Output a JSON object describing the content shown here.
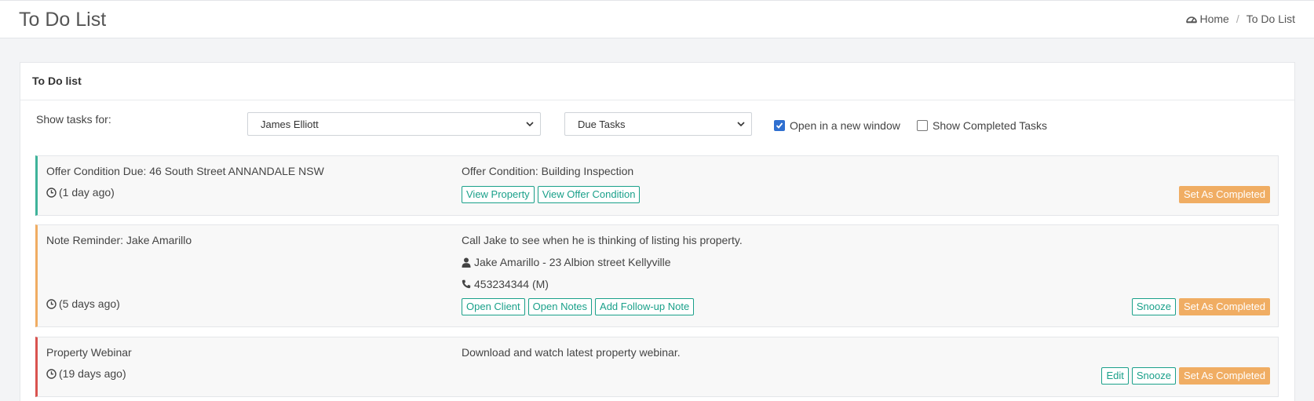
{
  "header": {
    "title": "To Do List",
    "breadcrumb": {
      "home": "Home",
      "current": "To Do List",
      "separator": "/"
    }
  },
  "panel": {
    "title": "To Do list",
    "filters": {
      "label": "Show tasks for:",
      "user_select": "James Elliott",
      "type_select": "Due Tasks",
      "open_new_window": {
        "label": "Open in a new window",
        "checked": true
      },
      "show_completed": {
        "label": "Show Completed Tasks",
        "checked": false
      }
    }
  },
  "tasks": [
    {
      "title": "Offer Condition Due: 46 South Street ANNANDALE NSW",
      "time": "(1 day ago)",
      "description": "Offer Condition: Building Inspection",
      "buttons": [
        "View Property",
        "View Offer Condition"
      ],
      "right_buttons": [
        "Set As Completed"
      ],
      "accent": "#3fb39a"
    },
    {
      "title": "Note Reminder: Jake Amarillo",
      "time": "(5 days ago)",
      "description": "Call Jake to see when he is thinking of listing his property.",
      "contact": "Jake Amarillo - 23 Albion street Kellyville",
      "phone": "453234344 (M)",
      "buttons": [
        "Open Client",
        "Open Notes",
        "Add Follow-up Note"
      ],
      "right_buttons": [
        "Snooze",
        "Set As Completed"
      ],
      "accent": "#f0ad63"
    },
    {
      "title": "Property Webinar",
      "time": "(19 days ago)",
      "description": "Download and watch latest property webinar.",
      "buttons": [],
      "right_buttons": [
        "Edit",
        "Snooze",
        "Set As Completed"
      ],
      "accent": "#d9534f"
    }
  ],
  "colors": {
    "accent_teal": "#1aa08a",
    "complete_orange": "#f0ad63",
    "checkbox_blue": "#2f6fd0"
  }
}
